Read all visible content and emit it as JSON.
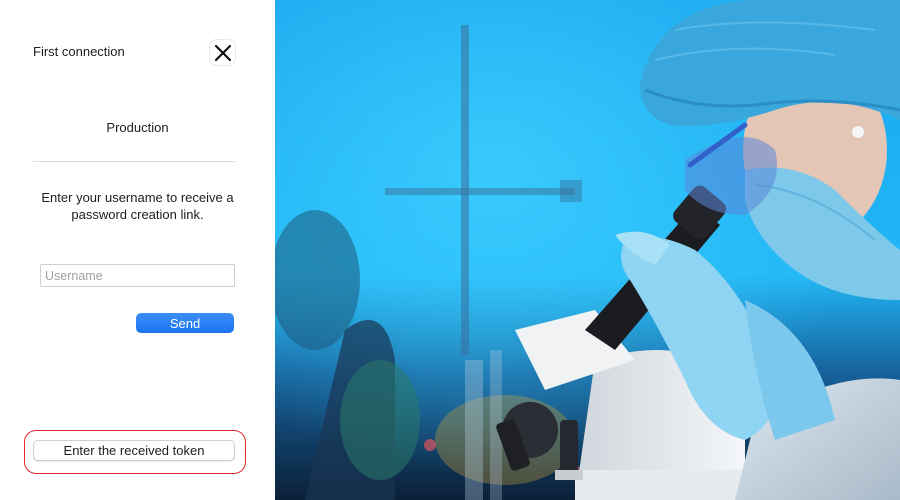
{
  "dialog": {
    "title": "First connection",
    "close_icon": "close-x-icon",
    "environment": "Production",
    "instructions": "Enter your username to receive a password creation link.",
    "username": {
      "value": "",
      "placeholder": "Username"
    },
    "send_label": "Send",
    "token_label": "Enter the received token"
  },
  "colors": {
    "accent": "#1a73f0",
    "highlight_ring": "#e0242b",
    "photo_background": "#1fb6f5"
  },
  "photo": {
    "subject": "scientist-looking-into-microscope-image"
  }
}
